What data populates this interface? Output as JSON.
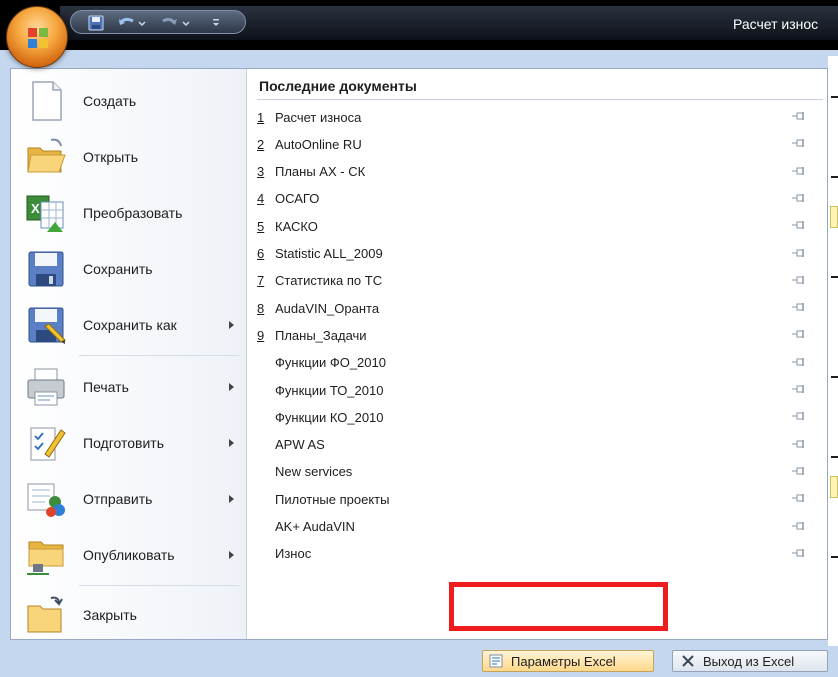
{
  "window": {
    "title": "Расчет износ"
  },
  "office_button": {
    "icon": "office-logo-icon"
  },
  "quick_access": {
    "save_icon": "save-icon",
    "undo_icon": "undo-icon",
    "redo_icon": "redo-icon",
    "customize_icon": "customize-dropdown-icon"
  },
  "commands": [
    {
      "label": "Создать",
      "icon": "new-document-icon",
      "submenu": false
    },
    {
      "label": "Открыть",
      "icon": "open-folder-icon",
      "submenu": false
    },
    {
      "label": "Преобразовать",
      "icon": "convert-icon",
      "submenu": false
    },
    {
      "label": "Сохранить",
      "icon": "save-disk-icon",
      "submenu": false
    },
    {
      "label": "Сохранить как",
      "icon": "save-as-icon",
      "submenu": true
    },
    {
      "label": "Печать",
      "icon": "printer-icon",
      "submenu": true
    },
    {
      "label": "Подготовить",
      "icon": "prepare-icon",
      "submenu": true
    },
    {
      "label": "Отправить",
      "icon": "send-icon",
      "submenu": true
    },
    {
      "label": "Опубликовать",
      "icon": "publish-icon",
      "submenu": true
    },
    {
      "label": "Закрыть",
      "icon": "close-folder-icon",
      "submenu": false
    }
  ],
  "recent": {
    "title": "Последние документы",
    "documents": [
      {
        "num": "1",
        "name": "Расчет износа"
      },
      {
        "num": "2",
        "name": "AutoOnline RU"
      },
      {
        "num": "3",
        "name": "Планы АХ - СК"
      },
      {
        "num": "4",
        "name": "ОСАГО"
      },
      {
        "num": "5",
        "name": "КАСКО"
      },
      {
        "num": "6",
        "name": "Statistic ALL_2009"
      },
      {
        "num": "7",
        "name": "Статистика по ТС"
      },
      {
        "num": "8",
        "name": "AudaVIN_Оранта"
      },
      {
        "num": "9",
        "name": "Планы_Задачи"
      },
      {
        "num": "",
        "name": "Функции ФО_2010"
      },
      {
        "num": "",
        "name": "Функции ТО_2010"
      },
      {
        "num": "",
        "name": "Функции КО_2010"
      },
      {
        "num": "",
        "name": "APW AS"
      },
      {
        "num": "",
        "name": "New services"
      },
      {
        "num": "",
        "name": "Пилотные проекты"
      },
      {
        "num": "",
        "name": "AK+ AudaVIN"
      },
      {
        "num": "",
        "name": "Износ"
      }
    ]
  },
  "footer": {
    "options_label": "Параметры Excel",
    "exit_label": "Выход из Excel",
    "highlight_color": "#ee1c1c"
  }
}
